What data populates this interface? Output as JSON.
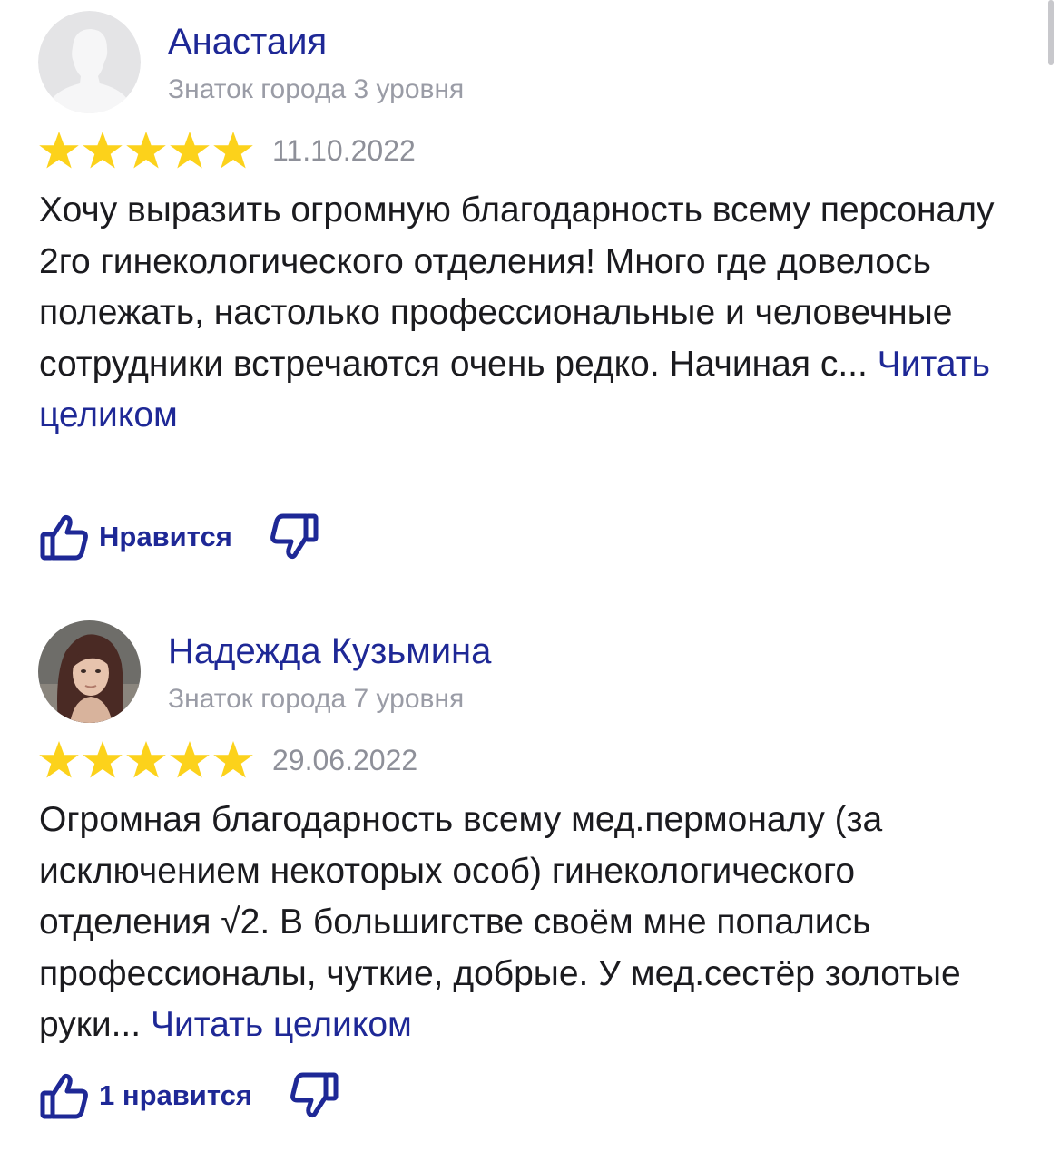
{
  "reviews": [
    {
      "author": "Анастаия",
      "level": "Знаток города 3 уровня",
      "avatar_icon": "default-user-silhouette-icon",
      "rating": 5,
      "date": "11.10.2022",
      "text": "Хочу выразить огромную благодарность всему персоналу 2го гинекологического отделения! Много где довелось полежать, настолько профессиональные и человечные сотрудники встречаются очень редко. Начиная с...",
      "read_more": "Читать целиком",
      "like_label": "Нравится"
    },
    {
      "author": "Надежда Кузьмина",
      "level": "Знаток города 7 уровня",
      "avatar_icon": "user-photo",
      "rating": 5,
      "date": "29.06.2022",
      "text": "Огромная благодарность всему мед.пермоналу (за исключением некоторых особ) гинекологического отделения √2. В большигстве своём мне попались профессионалы, чуткие, добрые. У мед.сестёр золотые руки...",
      "read_more": "Читать целиком",
      "like_label": "1 нравится"
    }
  ],
  "colors": {
    "accent": "#1e2896",
    "star": "#fcd21b",
    "muted": "#9a9ca6",
    "text": "#1b1b1f"
  }
}
